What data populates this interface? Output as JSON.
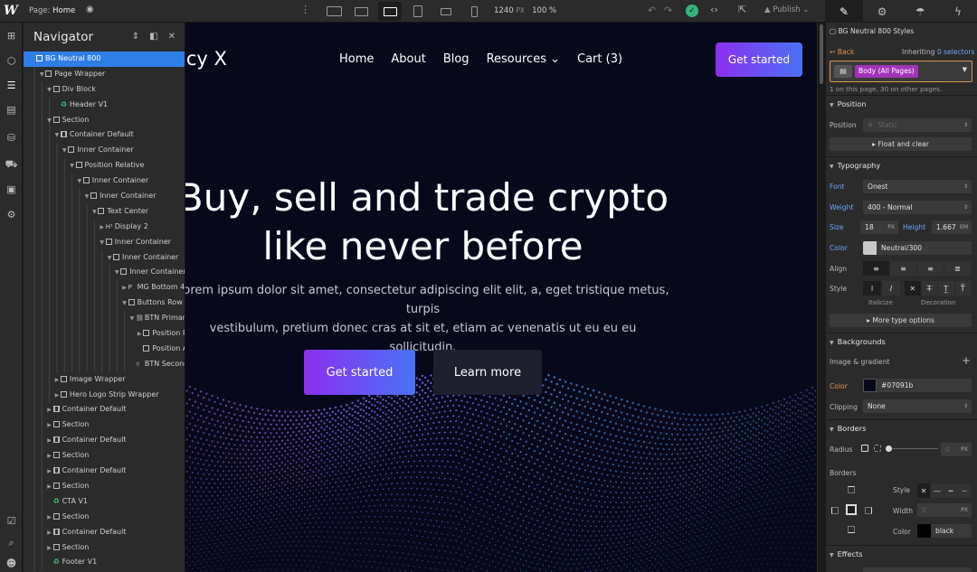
{
  "topbar": {
    "logo": "W",
    "page_label": "Page:",
    "page_name": "Home",
    "width": "1240",
    "width_unit": "PX",
    "zoom": "100 %",
    "publish": "Publish"
  },
  "navigator": {
    "title": "Navigator",
    "items": [
      {
        "label": "BG Neutral 800",
        "depth": 0,
        "caret": "",
        "icon": "box",
        "selected": true
      },
      {
        "label": "Page Wrapper",
        "depth": 1,
        "caret": "down",
        "icon": "box"
      },
      {
        "label": "Div Block",
        "depth": 2,
        "caret": "down",
        "icon": "box"
      },
      {
        "label": "Header V1",
        "depth": 3,
        "caret": "",
        "icon": "comp"
      },
      {
        "label": "Section",
        "depth": 2,
        "caret": "down",
        "icon": "box"
      },
      {
        "label": "Container Default",
        "depth": 3,
        "caret": "down",
        "icon": "cont"
      },
      {
        "label": "Inner Container",
        "depth": 4,
        "caret": "down",
        "icon": "box"
      },
      {
        "label": "Position Relative",
        "depth": 5,
        "caret": "down",
        "icon": "box"
      },
      {
        "label": "Inner Container",
        "depth": 6,
        "caret": "down",
        "icon": "box"
      },
      {
        "label": "Inner Container",
        "depth": 7,
        "caret": "down",
        "icon": "box"
      },
      {
        "label": "Text Center",
        "depth": 8,
        "caret": "down",
        "icon": "box"
      },
      {
        "label": "Display 2",
        "depth": 9,
        "caret": "right",
        "icon": "h1"
      },
      {
        "label": "Inner Container",
        "depth": 9,
        "caret": "down",
        "icon": "box"
      },
      {
        "label": "Inner Container",
        "depth": 10,
        "caret": "down",
        "icon": "box"
      },
      {
        "label": "Inner Container",
        "depth": 11,
        "caret": "down",
        "icon": "box"
      },
      {
        "label": "MG Bottom 48px",
        "depth": 12,
        "caret": "right",
        "icon": "p"
      },
      {
        "label": "Buttons Row",
        "depth": 12,
        "caret": "down",
        "icon": "box"
      },
      {
        "label": "BTN Primary",
        "depth": 13,
        "caret": "down",
        "icon": "link"
      },
      {
        "label": "Position Relative",
        "depth": 14,
        "caret": "right",
        "icon": "box"
      },
      {
        "label": "Position Absolute",
        "depth": 14,
        "caret": "",
        "icon": "box"
      },
      {
        "label": "BTN Secondary",
        "depth": 13,
        "caret": "",
        "icon": "cursor"
      },
      {
        "label": "Image Wrapper",
        "depth": 3,
        "caret": "right",
        "icon": "box"
      },
      {
        "label": "Hero Logo Strip Wrapper",
        "depth": 3,
        "caret": "right",
        "icon": "box"
      },
      {
        "label": "Container Default",
        "depth": 2,
        "caret": "right",
        "icon": "cont"
      },
      {
        "label": "Section",
        "depth": 2,
        "caret": "right",
        "icon": "box"
      },
      {
        "label": "Container Default",
        "depth": 2,
        "caret": "right",
        "icon": "cont"
      },
      {
        "label": "Section",
        "depth": 2,
        "caret": "right",
        "icon": "box"
      },
      {
        "label": "Container Default",
        "depth": 2,
        "caret": "right",
        "icon": "cont"
      },
      {
        "label": "Section",
        "depth": 2,
        "caret": "right",
        "icon": "box"
      },
      {
        "label": "CTA V1",
        "depth": 2,
        "caret": "",
        "icon": "comp"
      },
      {
        "label": "Section",
        "depth": 2,
        "caret": "right",
        "icon": "box"
      },
      {
        "label": "Container Default",
        "depth": 2,
        "caret": "right",
        "icon": "cont"
      },
      {
        "label": "Section",
        "depth": 2,
        "caret": "right",
        "icon": "box"
      },
      {
        "label": "Footer V1",
        "depth": 2,
        "caret": "",
        "icon": "comp"
      }
    ]
  },
  "site": {
    "brand": "acy X",
    "nav": [
      "Home",
      "About",
      "Blog",
      "Resources",
      "Cart (3)"
    ],
    "resources_chevron": "⌄",
    "header_cta": "Get started",
    "hero_line1": "Buy, sell and trade crypto",
    "hero_line2": "like never before",
    "lede_line1": "Lorem ipsum dolor sit amet, consectetur adipiscing elit elit, a, eget tristique metus, turpis",
    "lede_line2": "vestibulum, pretium donec cras at sit et, etiam ac venenatis ut eu eu eu sollicitudin.",
    "primary_button": "Get started",
    "secondary_button": "Learn more",
    "bg_color": "#07091b"
  },
  "style_panel": {
    "selector_name": "BG Neutral 800 Styles",
    "back": "Back",
    "inheriting": "Inheriting",
    "selectors": "0 selectors",
    "class_chip": "Body (All Pages)",
    "page_usage": "1 on this page, 30 on other pages.",
    "position": {
      "section": "Position",
      "label": "Position",
      "value": "Static",
      "float_clear": "Float and clear"
    },
    "typography": {
      "section": "Typography",
      "font_label": "Font",
      "font": "Onest",
      "weight_label": "Weight",
      "weight": "400 - Normal",
      "size_label": "Size",
      "size": "18",
      "size_unit": "PX",
      "height_label": "Height",
      "height": "1.667",
      "height_unit": "EM",
      "color_label": "Color",
      "color_name": "Neutral/300",
      "color_swatch": "#c8c8c8",
      "align_label": "Align",
      "style_label": "Style",
      "italicize": "Italicize",
      "decoration": "Decoration",
      "more": "More type options"
    },
    "backgrounds": {
      "section": "Backgrounds",
      "image_gradient": "Image & gradient",
      "color_label": "Color",
      "color_value": "#07091b",
      "clipping_label": "Clipping",
      "clipping_value": "None"
    },
    "borders": {
      "section": "Borders",
      "radius_label": "Radius",
      "radius_value": "0",
      "radius_unit": "PX",
      "borders_label": "Borders",
      "style_label": "Style",
      "width_label": "Width",
      "width_value": "0",
      "width_unit": "PX",
      "color_label": "Color",
      "color_value": "black",
      "color_swatch": "#000000"
    },
    "effects": {
      "section": "Effects"
    }
  },
  "accent_colors": {
    "selection": "#2f7ee6",
    "gradient_start": "#8b2ff0",
    "gradient_end": "#4a72f5",
    "component_green": "#3ccf7f",
    "chip_magenta": "#a233b8",
    "check_green": "#36b37e"
  }
}
